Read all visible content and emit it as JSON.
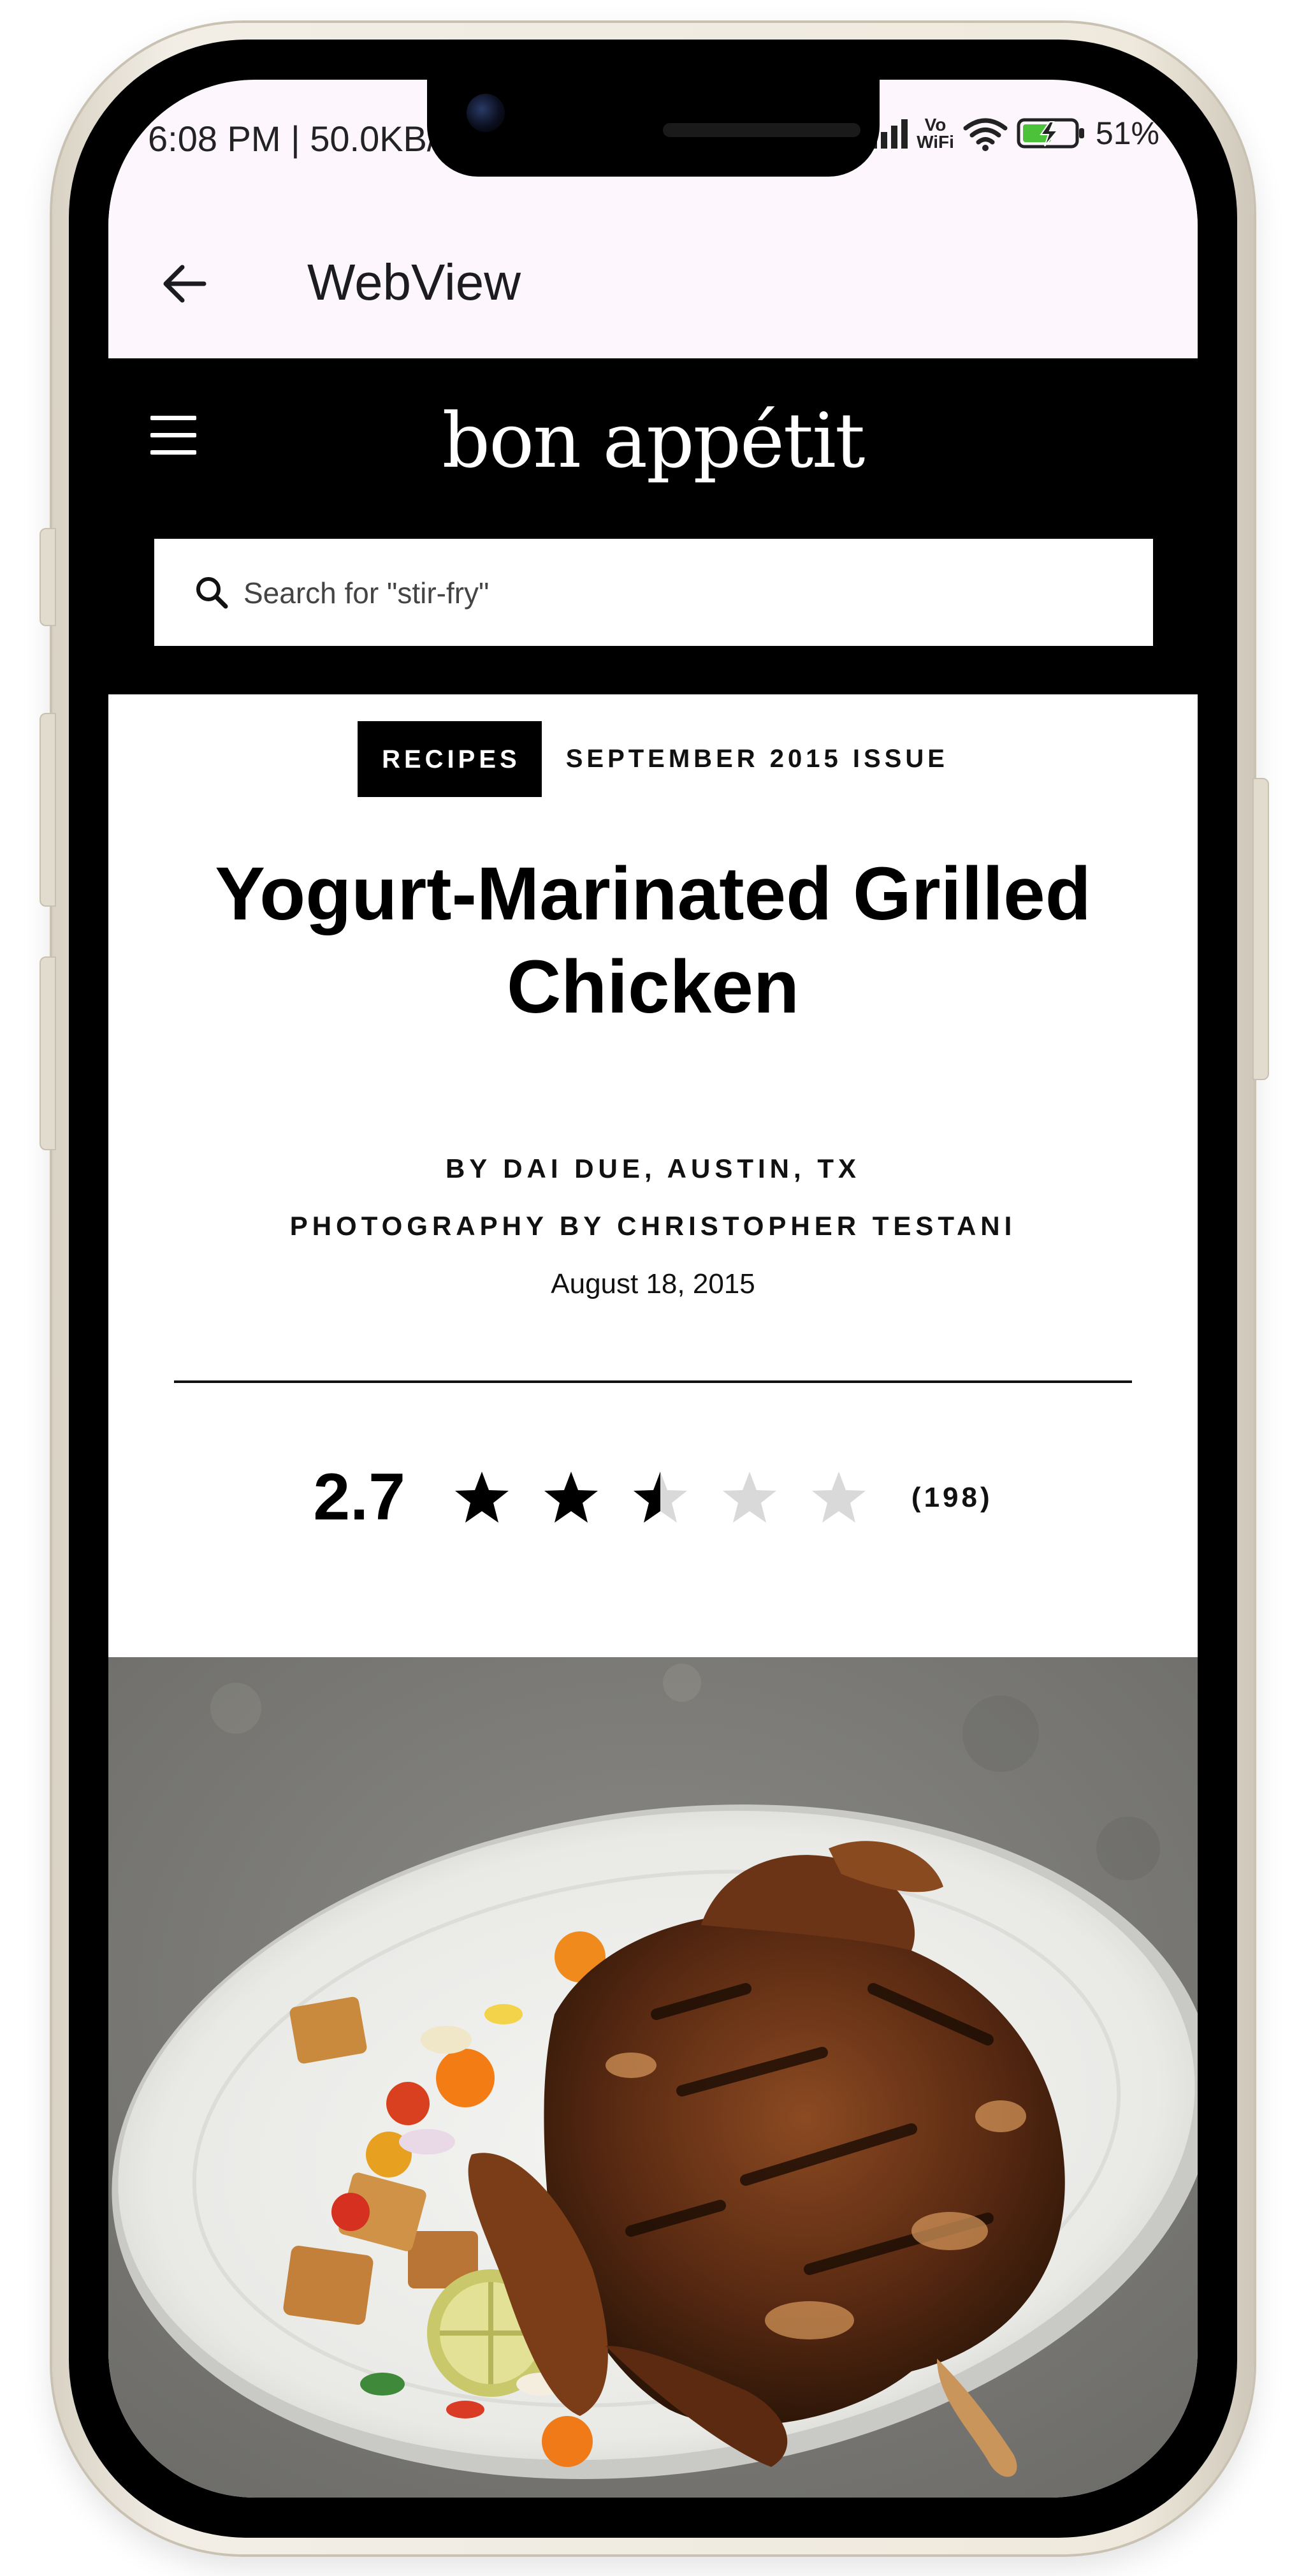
{
  "status_bar": {
    "time_data": "6:08 PM | 50.0KB/s",
    "vowifi_top": "Vo",
    "vowifi_bottom": "WiFi",
    "battery_percent": "51%"
  },
  "app_bar": {
    "title": "WebView",
    "back_icon": "arrow-left-icon"
  },
  "site_header": {
    "logo": "bon appétit",
    "menu_icon": "hamburger-menu-icon",
    "search_placeholder": "Search for \"stir-fry\"",
    "search_icon": "search-icon"
  },
  "article": {
    "category_tag": "RECIPES",
    "issue": "SEPTEMBER 2015 ISSUE",
    "title": "Yogurt-Marinated Grilled Chicken",
    "byline": "BY DAI DUE, AUSTIN, TX",
    "photo_credit": "PHOTOGRAPHY BY CHRISTOPHER TESTANI",
    "date": "August 18, 2015",
    "rating": {
      "value": "2.7",
      "stars_filled": 2.5,
      "stars_total": 5,
      "count": "(198)"
    }
  },
  "hero_image": {
    "subject": "grilled-chicken-plate-image"
  },
  "colors": {
    "app_bar_bg": "#fdf7fd",
    "header_bg": "#000000",
    "star_filled": "#000000",
    "star_empty": "#d9d9d9"
  }
}
